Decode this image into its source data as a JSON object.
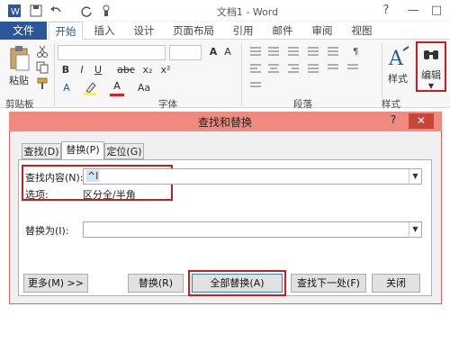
{
  "window": {
    "title": "文档1 - Word",
    "help": "?",
    "minimize": "—",
    "restore": "□"
  },
  "ribbon_tabs": [
    {
      "label": "文件",
      "selected": false
    },
    {
      "label": "开始",
      "selected": true
    },
    {
      "label": "插入",
      "selected": false
    },
    {
      "label": "设计",
      "selected": false
    },
    {
      "label": "页面布局",
      "selected": false
    },
    {
      "label": "引用",
      "selected": false
    },
    {
      "label": "邮件",
      "selected": false
    },
    {
      "label": "审阅",
      "selected": false
    },
    {
      "label": "视图",
      "selected": false
    }
  ],
  "ribbon": {
    "paste_label": "粘贴",
    "format_row1": [
      "B",
      "I",
      "U",
      "abc",
      "x₂",
      "x²"
    ],
    "format_row2": [
      "A",
      "Aa",
      "A"
    ],
    "styles_label": "样式",
    "edit_label": "编辑",
    "groups": [
      "剪贴板",
      "字体",
      "段落",
      "样式"
    ],
    "colors": {
      "file_tab": "#2b579a",
      "highlight_box": "#c81e1e"
    }
  },
  "dialog": {
    "title": "查找和替换",
    "help": "?",
    "close": "✕",
    "tabs": [
      {
        "label": "查找(D)",
        "selected": false
      },
      {
        "label": "替换(P)",
        "selected": true
      },
      {
        "label": "定位(G)",
        "selected": false
      }
    ],
    "find_label": "查找内容(N):",
    "find_value": "^l",
    "options_label": "选项:",
    "options_value": "区分全/半角",
    "replace_label": "替换为(I):",
    "replace_value": "",
    "buttons": {
      "more": "更多(M) >>",
      "replace": "替换(R)",
      "replace_all": "全部替换(A)",
      "find_next": "查找下一处(F)",
      "close": "关闭"
    }
  }
}
